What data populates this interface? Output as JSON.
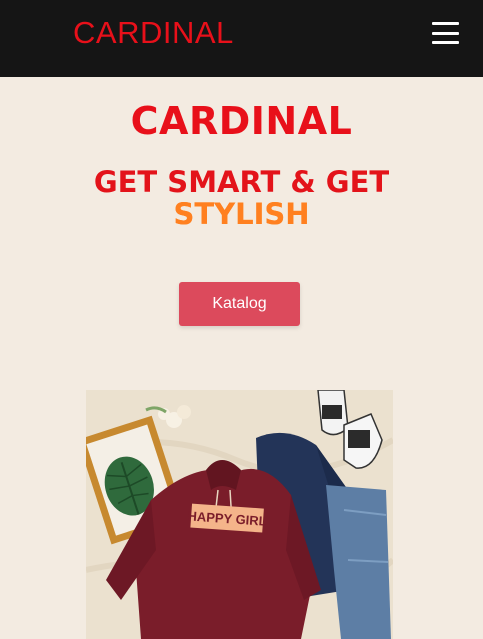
{
  "navbar": {
    "logo": "CARDINAL",
    "menu_icon": "hamburger-menu-icon"
  },
  "hero": {
    "brand": "CARDINAL",
    "tagline_line1": "GET SMART & GET",
    "tagline_line2": "STYLISH",
    "button_label": "Katalog"
  },
  "product_image": {
    "hoodie_print": "HAPPY GIRL"
  },
  "colors": {
    "navbar_bg": "#151515",
    "page_bg": "#f3ebe1",
    "brand_red": "#e8101a",
    "accent_orange": "#ff8020",
    "button_bg": "#dc4a5c"
  }
}
